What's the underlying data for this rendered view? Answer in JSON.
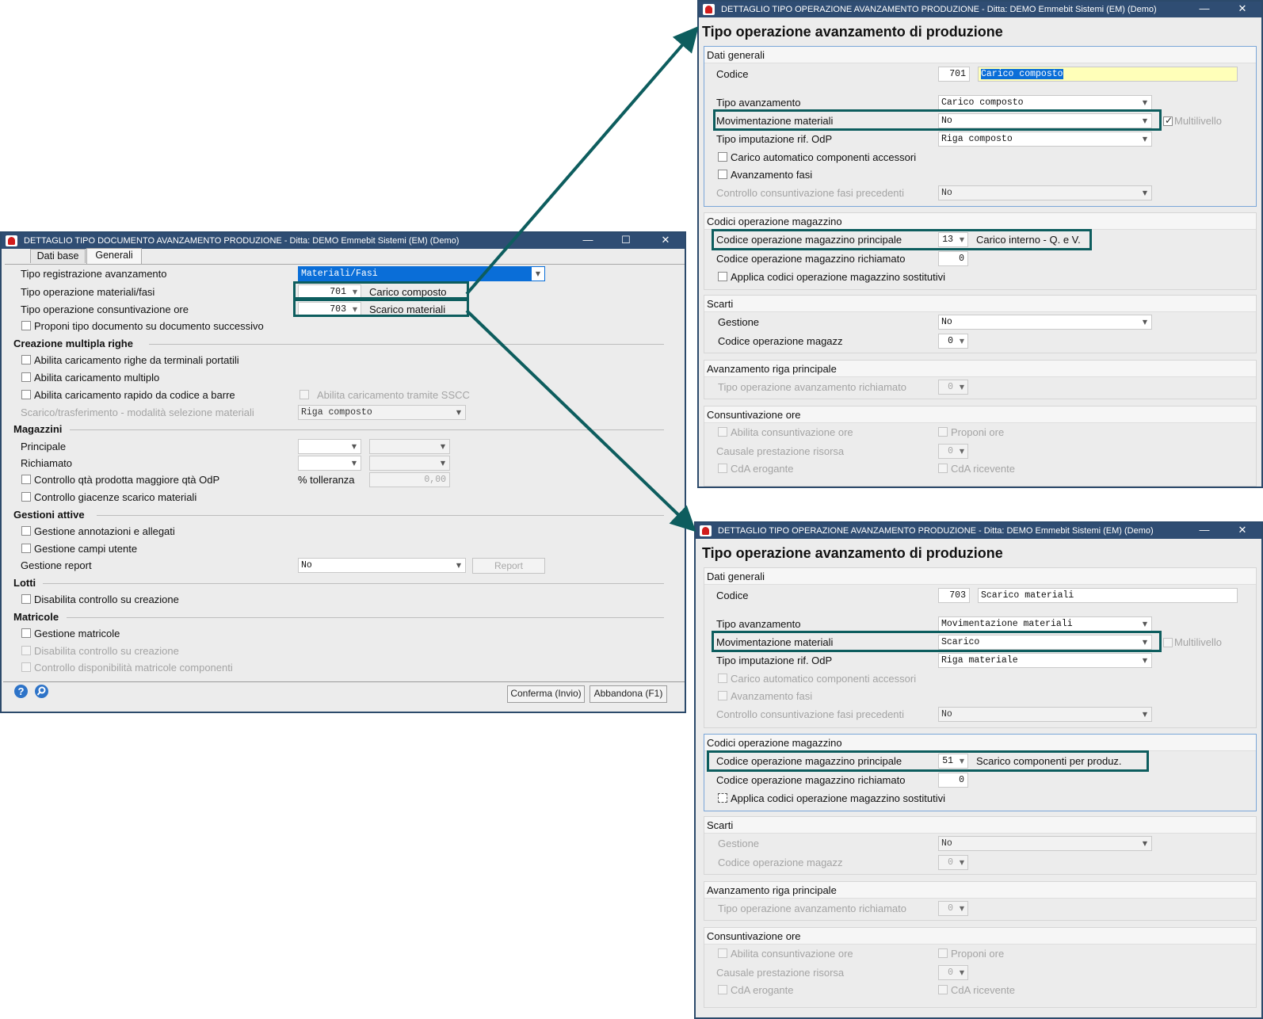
{
  "left_window": {
    "title": "DETTAGLIO TIPO DOCUMENTO AVANZAMENTO PRODUZIONE - Ditta: DEMO Emmebit Sistemi (EM)  (Demo)",
    "tabs": [
      "Dati base",
      "Generali"
    ],
    "tipo_registrazione": {
      "label": "Tipo registrazione avanzamento",
      "value": "Materiali/Fasi"
    },
    "tipo_op_materiali": {
      "label": "Tipo operazione materiali/fasi",
      "code": "701",
      "desc": "Carico composto"
    },
    "tipo_op_ore": {
      "label": "Tipo operazione consuntivazione ore",
      "code": "703",
      "desc": "Scarico materiali"
    },
    "proponi": "Proponi tipo documento su documento successivo",
    "sec_creazione": "Creazione multipla righe",
    "abilita_terminali": "Abilita caricamento righe da terminali portatili",
    "abilita_multiplo": "Abilita caricamento multiplo",
    "abilita_rapido": "Abilita caricamento rapido da codice a barre",
    "abilita_sscc": "Abilita caricamento tramite SSCC",
    "scarico_label": "Scarico/trasferimento - modalità selezione materiali",
    "scarico_value": "Riga composto",
    "sec_magazzini": "Magazzini",
    "principale": "Principale",
    "richiamato": "Richiamato",
    "controllo_qta": "Controllo qtà prodotta maggiore qtà OdP",
    "tolleranza_label": "% tolleranza",
    "tolleranza_value": "0,00",
    "controllo_giacenze": "Controllo giacenze scarico materiali",
    "sec_gestioni": "Gestioni attive",
    "gestione_annotazioni": "Gestione annotazioni e allegati",
    "gestione_campi": "Gestione campi utente",
    "gestione_report_label": "Gestione report",
    "gestione_report_value": "No",
    "report_button": "Report",
    "sec_lotti": "Lotti",
    "disabilita_lotti": "Disabilita controllo su creazione",
    "sec_matricole": "Matricole",
    "gestione_matricole": "Gestione matricole",
    "disabilita_matricole": "Disabilita controllo su creazione",
    "controllo_matricole": "Controllo disponibilità matricole componenti",
    "help_icon": "?",
    "confirm": "Conferma (Invio)",
    "cancel": "Abbandona (F1)"
  },
  "right_top": {
    "title": "DETTAGLIO TIPO OPERAZIONE AVANZAMENTO PRODUZIONE - Ditta: DEMO Emmebit Sistemi (EM)  (Demo)",
    "heading": "Tipo operazione avanzamento di produzione",
    "dati_generali": "Dati generali",
    "codice_label": "Codice",
    "codice": "701",
    "descrizione": "Carico composto",
    "tipo_avanzamento_label": "Tipo avanzamento",
    "tipo_avanzamento": "Carico composto",
    "movimentazione_label": "Movimentazione materiali",
    "movimentazione": "No",
    "multilivello": "Multilivello",
    "imputazione_label": "Tipo imputazione rif. OdP",
    "imputazione": "Riga composto",
    "carico_automatico": "Carico automatico componenti accessori",
    "avanzamento_fasi": "Avanzamento fasi",
    "controllo_fasi_label": "Controllo consuntivazione fasi precedenti",
    "controllo_fasi": "No",
    "codici_op": "Codici operazione magazzino",
    "cod_principale_label": "Codice operazione magazzino principale",
    "cod_principale": "13",
    "cod_principale_desc": "Carico interno - Q. e V.",
    "cod_richiamato_label": "Codice operazione magazzino richiamato",
    "cod_richiamato": "0",
    "applica_sostitutivi": "Applica codici operazione magazzino sostitutivi",
    "scarti": "Scarti",
    "gestione_label": "Gestione",
    "gestione": "No",
    "cod_magazz_label": "Codice operazione magazz",
    "cod_magazz": "0",
    "avanz_riga": "Avanzamento riga principale",
    "tipo_op_richiamato_label": "Tipo operazione avanzamento richiamato",
    "tipo_op_richiamato": "0",
    "consuntivazione": "Consuntivazione ore",
    "abilita_ore": "Abilita consuntivazione ore",
    "proponi_ore": "Proponi ore",
    "causale_label": "Causale prestazione risorsa",
    "causale": "0",
    "cda_erogante": "CdA erogante",
    "cda_ricevente": "CdA ricevente"
  },
  "right_bottom": {
    "title": "DETTAGLIO TIPO OPERAZIONE AVANZAMENTO PRODUZIONE - Ditta: DEMO Emmebit Sistemi (EM)  (Demo)",
    "heading": "Tipo operazione avanzamento di produzione",
    "dati_generali": "Dati generali",
    "codice_label": "Codice",
    "codice": "703",
    "descrizione": "Scarico materiali",
    "tipo_avanzamento_label": "Tipo avanzamento",
    "tipo_avanzamento": "Movimentazione materiali",
    "movimentazione_label": "Movimentazione materiali",
    "movimentazione": "Scarico",
    "multilivello": "Multilivello",
    "imputazione_label": "Tipo imputazione rif. OdP",
    "imputazione": "Riga materiale",
    "carico_automatico": "Carico automatico componenti accessori",
    "avanzamento_fasi": "Avanzamento fasi",
    "controllo_fasi_label": "Controllo consuntivazione fasi precedenti",
    "controllo_fasi": "No",
    "codici_op": "Codici operazione magazzino",
    "cod_principale_label": "Codice operazione magazzino principale",
    "cod_principale": "51",
    "cod_principale_desc": "Scarico componenti per produz.",
    "cod_richiamato_label": "Codice operazione magazzino richiamato",
    "cod_richiamato": "0",
    "applica_sostitutivi": "Applica codici operazione magazzino sostitutivi",
    "scarti": "Scarti",
    "gestione_label": "Gestione",
    "gestione": "No",
    "cod_magazz_label": "Codice operazione magazz",
    "cod_magazz": "0",
    "avanz_riga": "Avanzamento riga principale",
    "tipo_op_richiamato_label": "Tipo operazione avanzamento richiamato",
    "tipo_op_richiamato": "0",
    "consuntivazione": "Consuntivazione ore",
    "abilita_ore": "Abilita consuntivazione ore",
    "proponi_ore": "Proponi ore",
    "causale_label": "Causale prestazione risorsa",
    "causale": "0",
    "cda_erogante": "CdA erogante",
    "cda_ricevente": "CdA ricevente"
  },
  "colors": {
    "titlebar": "#2f4d73",
    "highlight_box": "#0d5d5e",
    "selection": "#0a6ed8"
  }
}
